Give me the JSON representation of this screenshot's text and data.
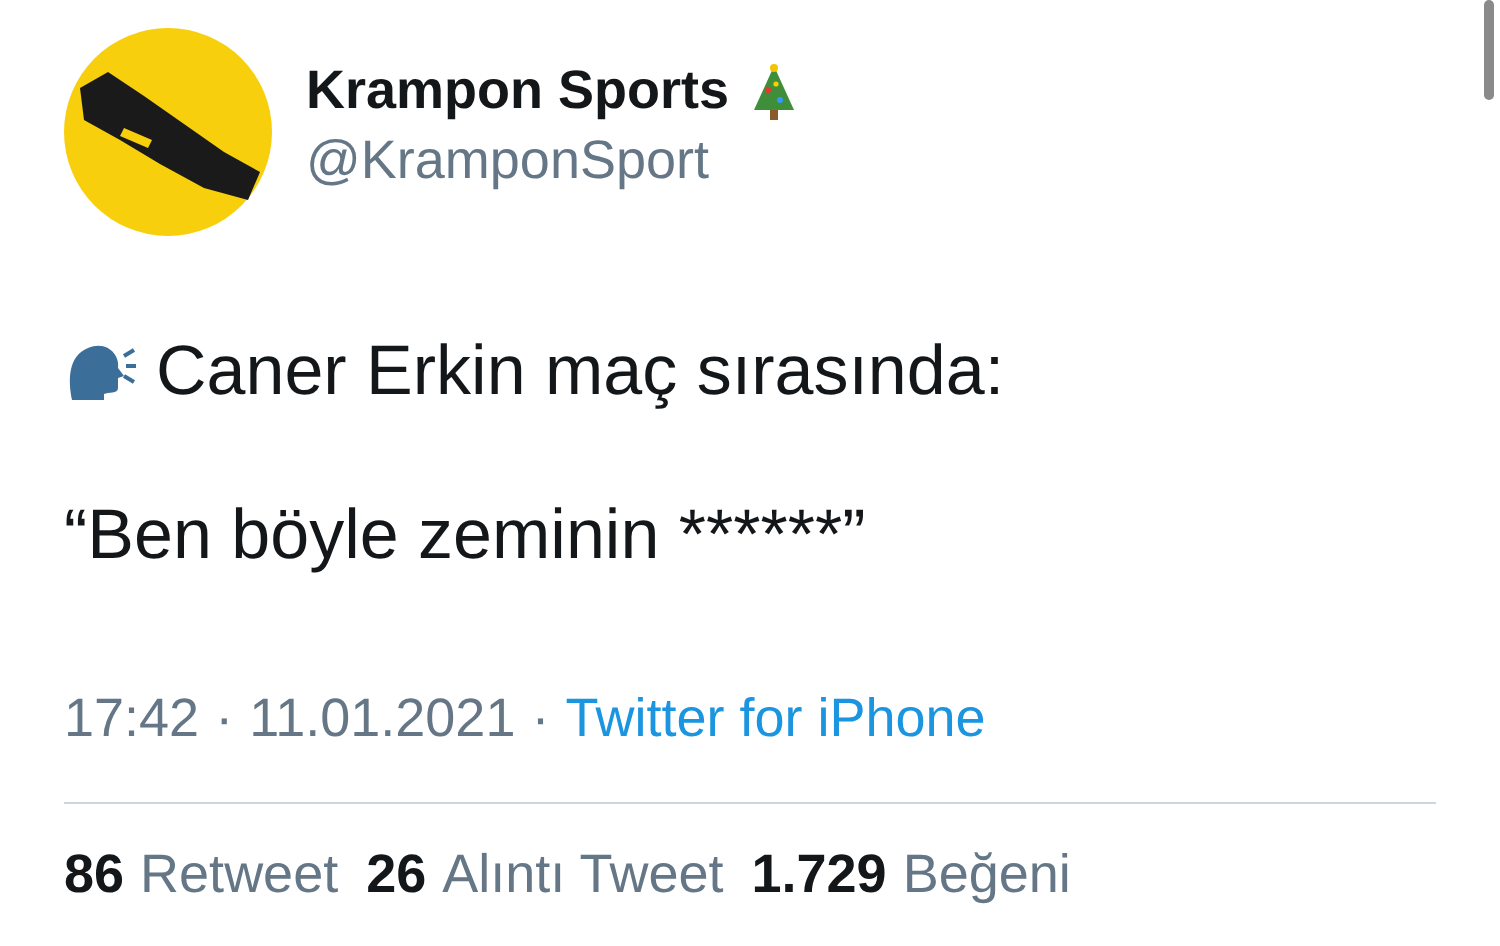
{
  "author": {
    "name": "Krampon Sports",
    "handle": "@KramponSport"
  },
  "tweet": {
    "lines": [
      "Caner Erkin maç sırasında:",
      "“Ben böyle zeminin ******”"
    ]
  },
  "meta": {
    "time": "17:42",
    "separator_1": "·",
    "date": "11.01.2021",
    "separator_2": "·",
    "source": "Twitter for iPhone"
  },
  "stats": [
    {
      "count": "86",
      "label": "Retweet"
    },
    {
      "count": "26",
      "label": "Alıntı Tweet"
    },
    {
      "count": "1.729",
      "label": "Beğeni"
    }
  ]
}
